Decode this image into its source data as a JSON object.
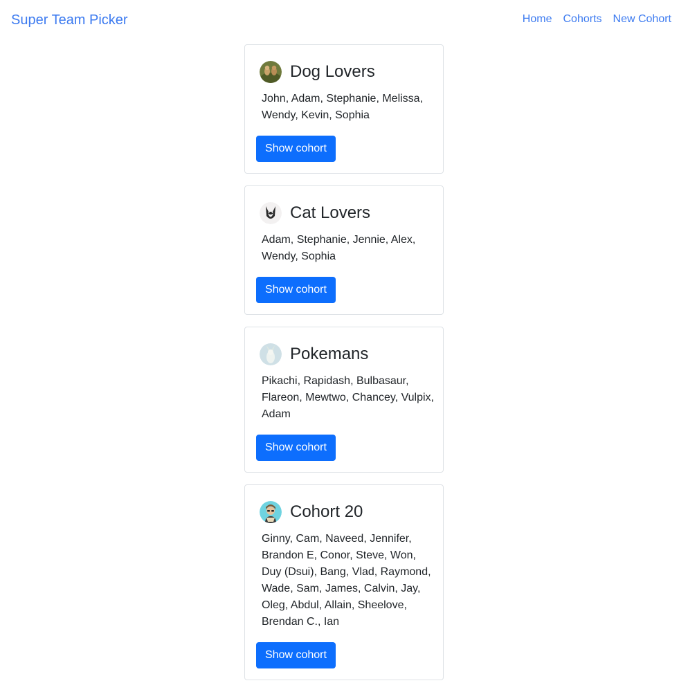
{
  "nav": {
    "brand": "Super Team Picker",
    "links": [
      "Home",
      "Cohorts",
      "New Cohort"
    ]
  },
  "cohorts": [
    {
      "name": "Dog Lovers",
      "avatar_icon": "dog-avatar-icon",
      "members": "John, Adam, Stephanie, Melissa, Wendy, Kevin, Sophia",
      "button": "Show cohort"
    },
    {
      "name": "Cat Lovers",
      "avatar_icon": "cat-avatar-icon",
      "members": "Adam, Stephanie, Jennie, Alex, Wendy, Sophia",
      "button": "Show cohort"
    },
    {
      "name": "Pokemans",
      "avatar_icon": "pokemon-avatar-icon",
      "members": "Pikachi, Rapidash, Bulbasaur, Flareon, Mewtwo, Chancey, Vulpix, Adam",
      "button": "Show cohort"
    },
    {
      "name": "Cohort 20",
      "avatar_icon": "person-avatar-icon",
      "members": "Ginny, Cam, Naveed, Jennifer, Brandon E, Conor, Steve, Won, Duy (Dsui), Bang, Vlad, Raymond, Wade, Sam, James, Calvin, Jay, Oleg, Abdul, Allain, Sheelove, Brendan C., Ian",
      "button": "Show cohort"
    }
  ],
  "colors": {
    "link": "#3d7bf0",
    "button": "#0d6efd",
    "card_border": "#dee2e6"
  }
}
